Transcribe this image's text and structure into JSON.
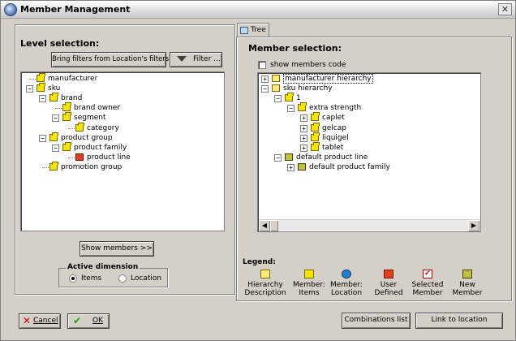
{
  "window": {
    "title": "Member Management"
  },
  "left": {
    "level_selection_label": "Level selection:",
    "bring_filters_label": "Bring filters from Location's filters",
    "filter_label": "Filter ...",
    "tree": [
      {
        "label": "manufacturer",
        "depth": 0,
        "expander": ""
      },
      {
        "label": "sku",
        "depth": 0,
        "expander": "-"
      },
      {
        "label": "brand",
        "depth": 1,
        "expander": "-"
      },
      {
        "label": "brand owner",
        "depth": 2,
        "expander": ""
      },
      {
        "label": "segment",
        "depth": 2,
        "expander": "-"
      },
      {
        "label": "category",
        "depth": 3,
        "expander": ""
      },
      {
        "label": "product group",
        "depth": 1,
        "expander": "-"
      },
      {
        "label": "product family",
        "depth": 2,
        "expander": "-"
      },
      {
        "label": "product line",
        "depth": 3,
        "expander": "",
        "icon": "user-defined"
      },
      {
        "label": "promotion group",
        "depth": 1,
        "expander": ""
      }
    ],
    "show_members_label": "Show members >>",
    "active_dimension_label": "Active dimension",
    "radio_items_label": "Items",
    "radio_location_label": "Location",
    "selected_dimension": "Items"
  },
  "right": {
    "tab_label": "Tree",
    "member_selection_label": "Member selection:",
    "show_code_label": "show members code",
    "tree": [
      {
        "label": "manufacturer hierarchy",
        "depth": 0,
        "expander": "+",
        "icon": "folder",
        "selected": true
      },
      {
        "label": "sku hierarchy",
        "depth": 0,
        "expander": "-",
        "icon": "folder"
      },
      {
        "label": "1",
        "depth": 1,
        "expander": "-",
        "icon": "item"
      },
      {
        "label": "extra strength",
        "depth": 2,
        "expander": "-",
        "icon": "item"
      },
      {
        "label": "caplet",
        "depth": 3,
        "expander": "+",
        "icon": "item"
      },
      {
        "label": "gelcap",
        "depth": 3,
        "expander": "+",
        "icon": "item"
      },
      {
        "label": "liquigel",
        "depth": 3,
        "expander": "+",
        "icon": "item"
      },
      {
        "label": "tablet",
        "depth": 3,
        "expander": "+",
        "icon": "item"
      },
      {
        "label": "default product line",
        "depth": 1,
        "expander": "-",
        "icon": "new"
      },
      {
        "label": "default product family",
        "depth": 2,
        "expander": "+",
        "icon": "new"
      }
    ],
    "legend_label": "Legend:",
    "legend": [
      {
        "line1": "Hierarchy",
        "line2": "Description",
        "icon": "folder-icon"
      },
      {
        "line1": "Member:",
        "line2": "Items",
        "icon": "item-icon"
      },
      {
        "line1": "Member:",
        "line2": "Location",
        "icon": "globe-icon"
      },
      {
        "line1": "User",
        "line2": "Defined",
        "icon": "user-defined-icon"
      },
      {
        "line1": "Selected",
        "line2": "Member",
        "icon": "checkmark-icon"
      },
      {
        "line1": "New",
        "line2": "Member",
        "icon": "new-member-icon"
      }
    ]
  },
  "footer": {
    "cancel_label": "Cancel",
    "ok_label": "OK",
    "combinations_label": "Combinations list",
    "link_location_label": "Link to location"
  }
}
